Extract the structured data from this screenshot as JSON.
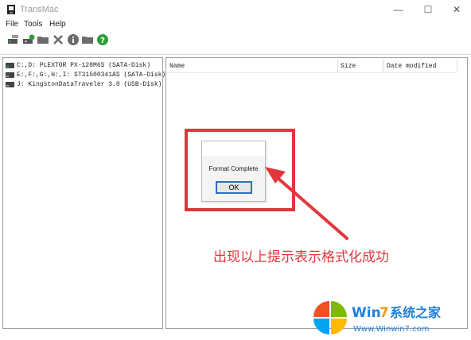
{
  "window": {
    "title": "TransMac",
    "minimize": "—",
    "maximize": "☐",
    "close": "✕"
  },
  "menu": [
    "File",
    "Tools",
    "Help"
  ],
  "toolbar": {
    "icons": [
      "drive-open-icon",
      "drive-format-icon",
      "folder-icon",
      "delete-icon",
      "info-icon",
      "folder-icon",
      "help-icon"
    ],
    "accent_green": "#2e9e3a",
    "accent_gray": "#6b6b6b"
  },
  "drives": [
    {
      "label": "C:,D: PLEXTOR PX-128M6S (SATA-Disk)"
    },
    {
      "label": "E:,F:,G:,H:,I: ST31500341AS (SATA-Disk)"
    },
    {
      "label": "J: KingstonDataTraveler 3.0 (USB-Disk)"
    }
  ],
  "file_list": {
    "columns": [
      "Name",
      "Size",
      "Date modified"
    ],
    "rows": []
  },
  "dialog": {
    "message": "Format Complete",
    "ok_label": "OK"
  },
  "annotation": {
    "text": "出现以上提示表示格式化成功",
    "color": "#e2363d"
  },
  "watermark": {
    "brand_prefix": "Win",
    "brand_number": "7",
    "brand_suffix": "系统之家",
    "url": "Www.Winwin7.com"
  }
}
